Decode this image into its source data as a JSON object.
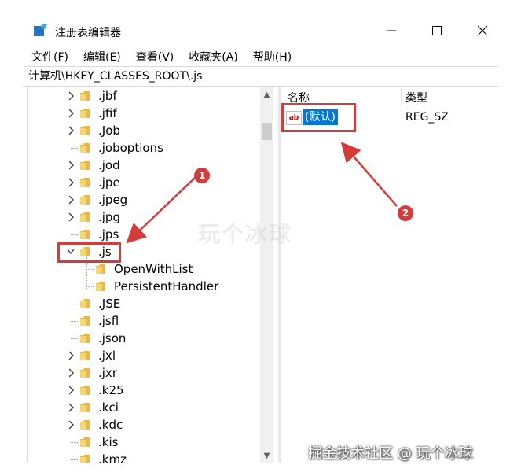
{
  "window": {
    "title": "注册表编辑器",
    "controls": {
      "minimize": "—",
      "maximize": "☐",
      "close": "✕"
    }
  },
  "menu": [
    "文件(F)",
    "编辑(E)",
    "查看(V)",
    "收藏夹(A)",
    "帮助(H)"
  ],
  "address": "计算机\\HKEY_CLASSES_ROOT\\.js",
  "tree": [
    {
      "label": ".jbf",
      "expandable": true
    },
    {
      "label": ".jfif",
      "expandable": true
    },
    {
      "label": ".Job",
      "expandable": true
    },
    {
      "label": ".joboptions",
      "expandable": false
    },
    {
      "label": ".jod",
      "expandable": true
    },
    {
      "label": ".jpe",
      "expandable": true
    },
    {
      "label": ".jpeg",
      "expandable": true
    },
    {
      "label": ".jpg",
      "expandable": true
    },
    {
      "label": ".jps",
      "expandable": false
    },
    {
      "label": ".js",
      "expandable": true,
      "expanded": true
    },
    {
      "label": "OpenWithList",
      "child": true
    },
    {
      "label": "PersistentHandler",
      "child": true
    },
    {
      "label": ".JSE",
      "expandable": false
    },
    {
      "label": ".jsfl",
      "expandable": false
    },
    {
      "label": ".json",
      "expandable": false
    },
    {
      "label": ".jxl",
      "expandable": true
    },
    {
      "label": ".jxr",
      "expandable": true
    },
    {
      "label": ".k25",
      "expandable": true
    },
    {
      "label": ".kci",
      "expandable": true
    },
    {
      "label": ".kdc",
      "expandable": true
    },
    {
      "label": ".kis",
      "expandable": false
    },
    {
      "label": ".kmz",
      "expandable": false
    }
  ],
  "list": {
    "headers": {
      "name": "名称",
      "type": "类型"
    },
    "entries": [
      {
        "icon": "ab",
        "name": "(默认)",
        "type": "REG_SZ"
      }
    ]
  },
  "annotations": {
    "badge1": "1",
    "badge2": "2",
    "color": "#d63b3b"
  },
  "watermark": {
    "center": "玩个冰球",
    "corner": "掘金技术社区 @ 玩个冰球"
  }
}
